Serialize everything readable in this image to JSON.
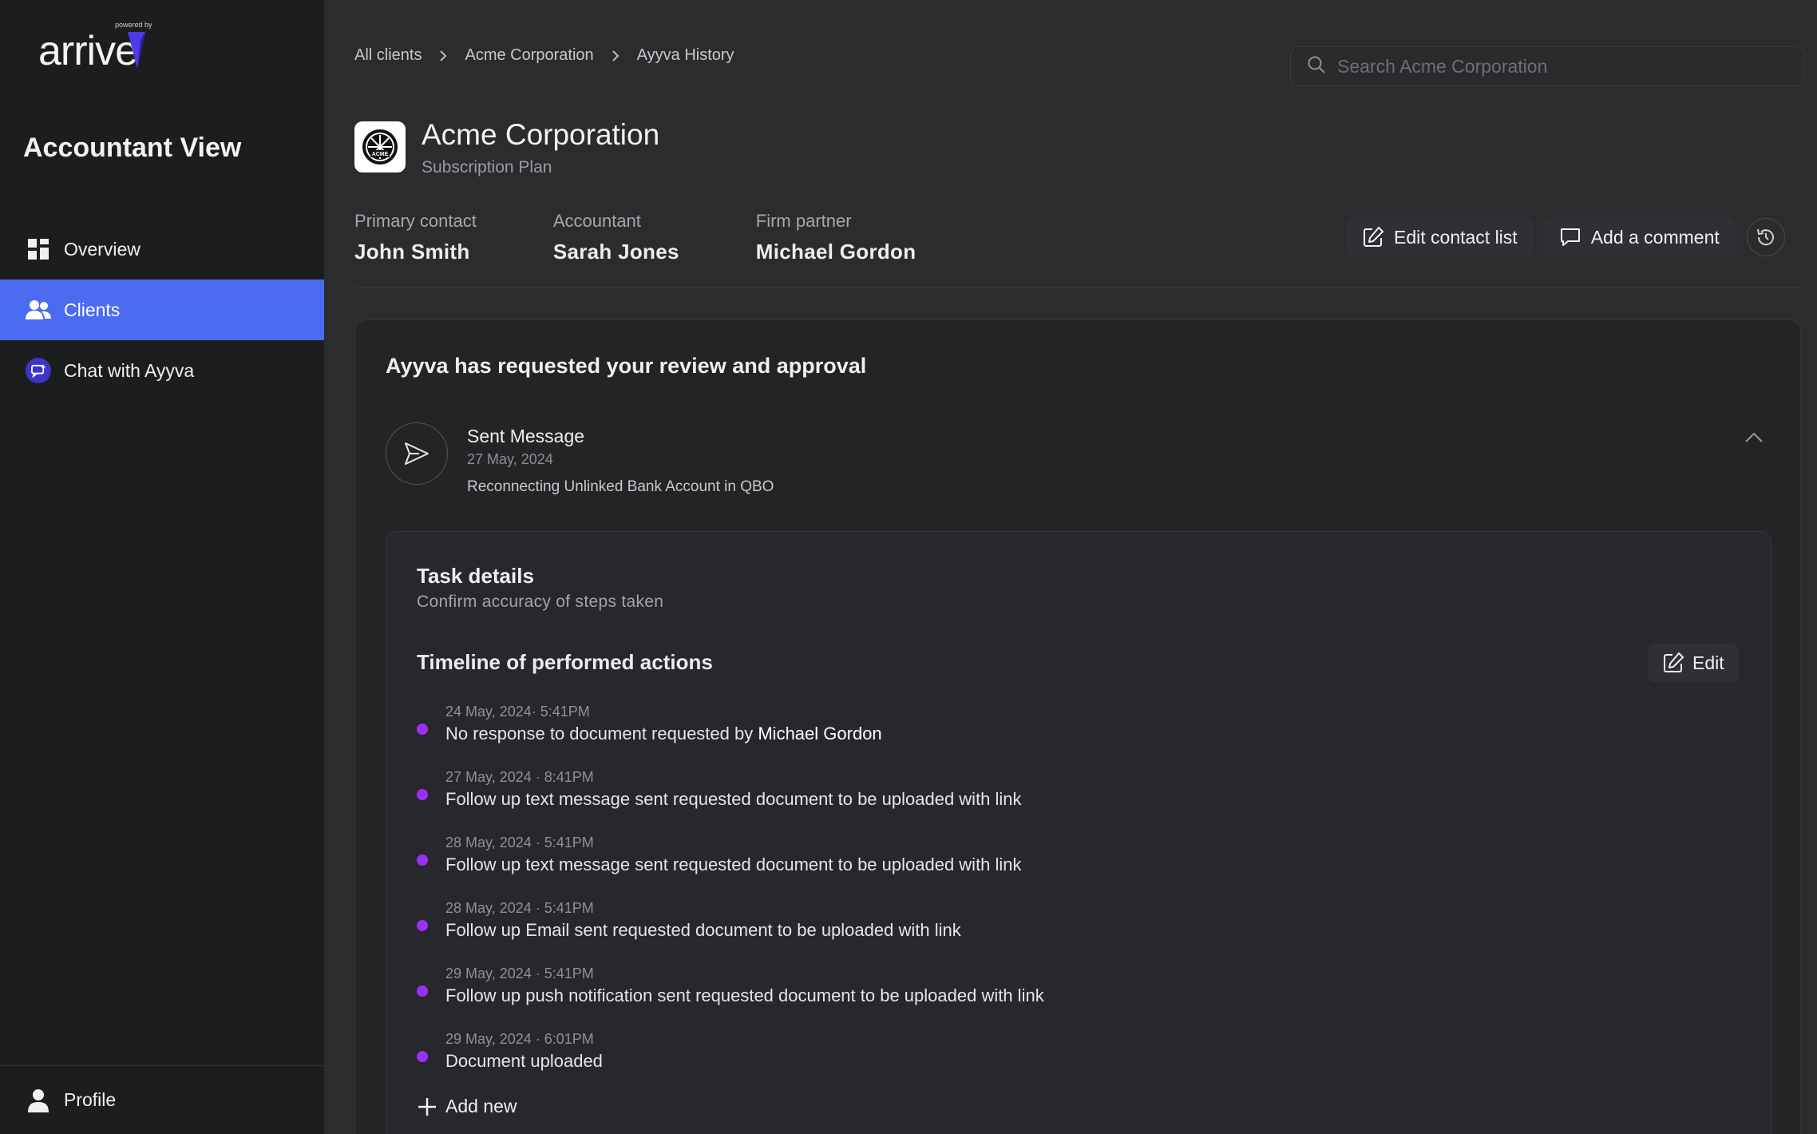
{
  "app": {
    "logo_powered": "powered by",
    "logo_word": "arrive",
    "view_title": "Accountant View",
    "accent_color": "#4b6bf0",
    "timeline_dot_color": "#9b2ff5"
  },
  "sidebar": {
    "items": [
      {
        "label": "Overview",
        "icon": "grid-icon",
        "active": false
      },
      {
        "label": "Clients",
        "icon": "users-icon",
        "active": true
      },
      {
        "label": "Chat with Ayyva",
        "icon": "chat-sparkle-icon",
        "active": false
      }
    ],
    "profile_label": "Profile"
  },
  "breadcrumb": [
    "All clients",
    "Acme Corporation",
    "Ayyva History"
  ],
  "search": {
    "placeholder": "Search Acme Corporation"
  },
  "company": {
    "name": "Acme Corporation",
    "plan": "Subscription Plan"
  },
  "contacts": [
    {
      "label": "Primary contact",
      "value": "John Smith"
    },
    {
      "label": "Accountant",
      "value": "Sarah Jones"
    },
    {
      "label": "Firm partner",
      "value": "Michael Gordon"
    }
  ],
  "actions": {
    "edit_contact": "Edit contact list",
    "add_comment": "Add a comment"
  },
  "review": {
    "title": "Ayyva has requested your review and approval",
    "message_title": "Sent Message",
    "message_date": "27 May, 2024",
    "message_subject": "Reconnecting Unlinked Bank Account in QBO"
  },
  "task": {
    "title": "Task details",
    "subtitle": "Confirm accuracy of steps taken",
    "timeline_title": "Timeline of performed actions",
    "edit_label": "Edit",
    "add_new_label": "Add new",
    "events": [
      {
        "time": "24 May, 2024· 5:41PM",
        "text": "No response to document requested by ",
        "strong": "Michael Gordon"
      },
      {
        "time": "27 May, 2024 · 8:41PM",
        "text": "Follow up text message sent requested document to be uploaded with link",
        "strong": ""
      },
      {
        "time": "28 May, 2024 · 5:41PM",
        "text": "Follow up text message sent requested document to be uploaded with link",
        "strong": ""
      },
      {
        "time": "28 May, 2024 · 5:41PM",
        "text": "Follow up Email sent requested document to be uploaded with link",
        "strong": ""
      },
      {
        "time": "29 May, 2024 · 5:41PM",
        "text": "Follow up push notification sent requested document to be uploaded with link",
        "strong": ""
      },
      {
        "time": "29 May, 2024 · 6:01PM",
        "text": "Document uploaded",
        "strong": ""
      }
    ]
  }
}
